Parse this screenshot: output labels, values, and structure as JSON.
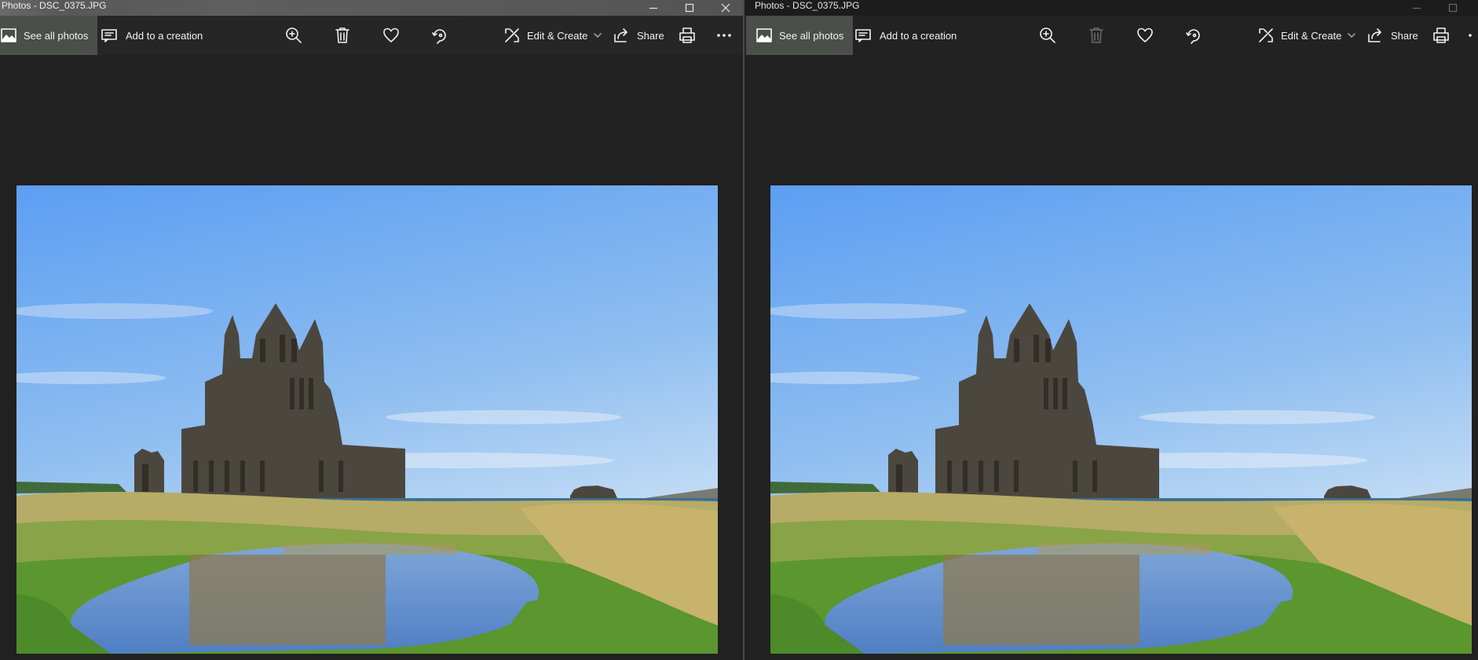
{
  "windows": [
    {
      "title": "Photos - DSC_0375.JPG",
      "active": true,
      "toolbar": {
        "see_all_photos": "See all photos",
        "add_to_creation": "Add to a creation",
        "edit_create": "Edit & Create",
        "share": "Share"
      }
    },
    {
      "title": "Photos - DSC_0375.JPG",
      "active": false,
      "toolbar": {
        "see_all_photos": "See all photos",
        "add_to_creation": "Add to a creation",
        "edit_create": "Edit & Create",
        "share": "Share"
      }
    }
  ],
  "icons": {
    "see_all": "photos-icon",
    "creation": "add-to-creation-icon",
    "zoom": "zoom-in-icon",
    "delete": "trash-icon",
    "favorite": "heart-icon",
    "rotate": "rotate-icon",
    "edit": "edit-create-icon",
    "share": "share-icon",
    "print": "print-icon",
    "more": "more-icon",
    "minimize": "minimize-icon",
    "maximize": "maximize-icon",
    "close": "close-icon"
  },
  "colors": {
    "app_background": "#212121",
    "see_all_highlight": "#4a4f49",
    "sky_top": "#5ea1f0",
    "sky_bottom": "#cfe2f7",
    "grass": "#6da83a",
    "dry_grass": "#c9b46a",
    "ruin_stone": "#4a4740",
    "water": "#5e88c8"
  }
}
